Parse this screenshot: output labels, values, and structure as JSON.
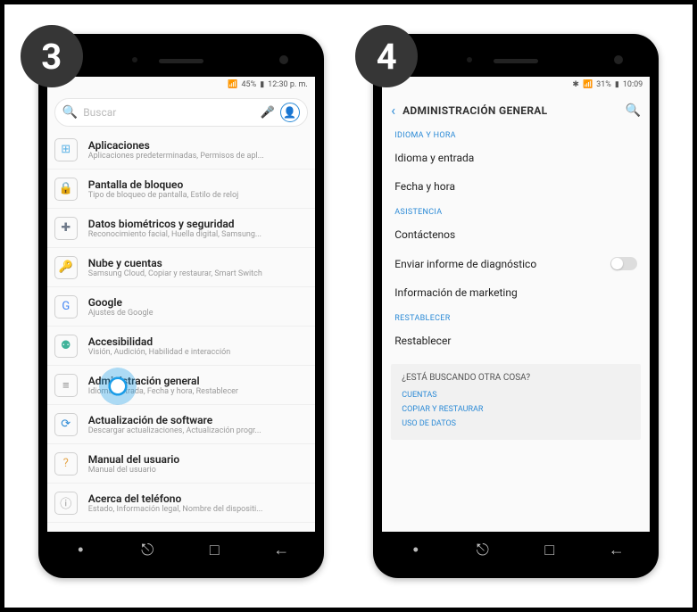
{
  "steps": [
    "3",
    "4"
  ],
  "left": {
    "status": {
      "signal": "📶",
      "battery_text": "45%",
      "time": "12:30 p. m."
    },
    "search_placeholder": "Buscar",
    "settings": [
      {
        "icon": "⊞",
        "icon_class": "c-apps",
        "title": "Aplicaciones",
        "sub": "Aplicaciones predeterminadas, Permisos de apl..."
      },
      {
        "icon": "🔒",
        "icon_class": "c-lock",
        "title": "Pantalla de bloqueo",
        "sub": "Tipo de bloqueo de pantalla, Estilo de reloj"
      },
      {
        "icon": "✚",
        "icon_class": "c-bio",
        "title": "Datos biométricos y seguridad",
        "sub": "Reconocimiento facial, Huella digital, Samsung..."
      },
      {
        "icon": "🔑",
        "icon_class": "c-cloud",
        "title": "Nube y cuentas",
        "sub": "Samsung Cloud, Copiar y restaurar, Smart Switch"
      },
      {
        "icon": "G",
        "icon_class": "c-google",
        "title": "Google",
        "sub": "Ajustes de Google"
      },
      {
        "icon": "⚉",
        "icon_class": "c-acc",
        "title": "Accesibilidad",
        "sub": "Visión, Audición, Habilidad e interacción"
      },
      {
        "icon": "≡",
        "icon_class": "c-gen",
        "title": "Administración general",
        "sub": "Idioma, entrada, Fecha y hora, Restablecer"
      },
      {
        "icon": "⟳",
        "icon_class": "c-upd",
        "title": "Actualización de software",
        "sub": "Descargar actualizaciones, Actualización progr..."
      },
      {
        "icon": "?",
        "icon_class": "c-manual",
        "title": "Manual del usuario",
        "sub": "Manual del usuario"
      },
      {
        "icon": "ⓘ",
        "icon_class": "c-about",
        "title": "Acerca del teléfono",
        "sub": "Estado, Información legal, Nombre del dispositi..."
      }
    ],
    "highlight_index": 6
  },
  "right": {
    "status": {
      "bt": "✱",
      "signal": "📶",
      "battery_text": "31%",
      "time": "10:09"
    },
    "header_title": "ADMINISTRACIÓN GENERAL",
    "sections": {
      "lang_time": {
        "label": "IDIOMA Y HORA",
        "items": [
          "Idioma y entrada",
          "Fecha y hora"
        ]
      },
      "assist": {
        "label": "ASISTENCIA",
        "items": [
          {
            "text": "Contáctenos"
          },
          {
            "text": "Enviar informe de diagnóstico",
            "toggle": true
          },
          {
            "text": "Información de marketing"
          }
        ]
      },
      "reset": {
        "label": "RESTABLECER",
        "items": [
          "Restablecer"
        ]
      }
    },
    "help": {
      "question": "¿ESTÁ BUSCANDO OTRA COSA?",
      "links": [
        "CUENTAS",
        "COPIAR Y RESTAURAR",
        "USO DE DATOS"
      ]
    },
    "highlight_item": "reset0"
  }
}
